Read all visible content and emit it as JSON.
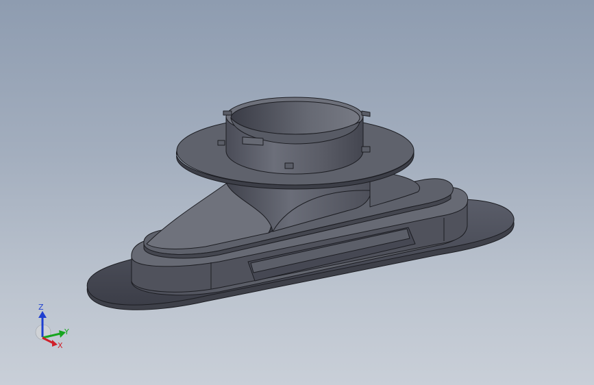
{
  "viewport": {
    "background_top": "#8e9cb0",
    "background_bottom": "#c9cfd8"
  },
  "model": {
    "icon": "cad-part-icon",
    "face_color": "#5d606c",
    "edge_color": "#1c1d22"
  },
  "triad": {
    "icon": "view-orientation-triad-icon",
    "z_label": "Z",
    "y_label": "Y",
    "x_label": "X",
    "z_color": "#1f3fd0",
    "y_color": "#17a51e",
    "x_color": "#d0202a"
  }
}
